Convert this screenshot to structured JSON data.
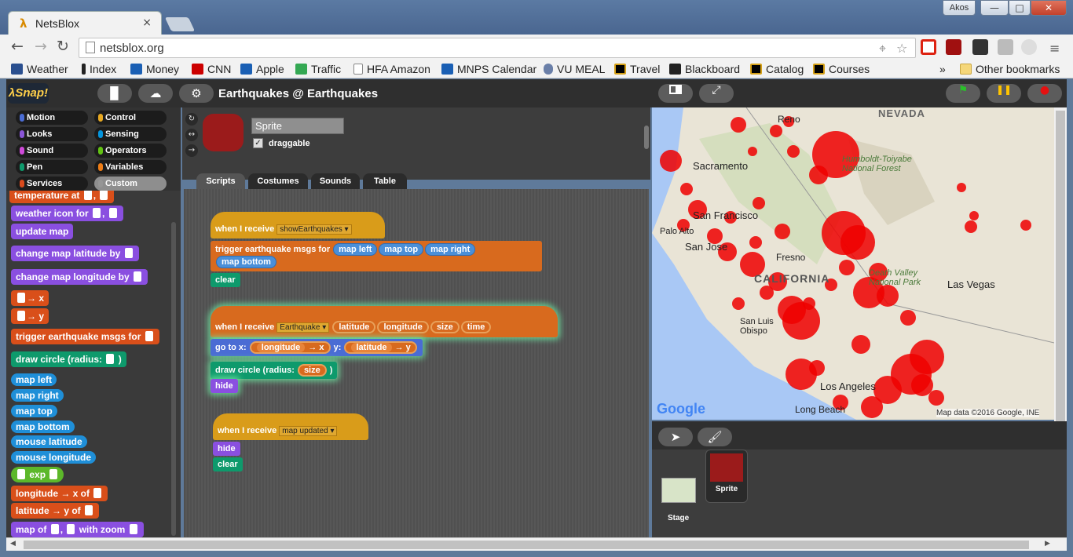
{
  "browser": {
    "tab_title": "NetsBlox",
    "tab_close": "×",
    "profile_label": "Akos",
    "window_buttons": [
      "—",
      "□",
      "✕"
    ],
    "url": "netsblox.org",
    "nav": {
      "back": "←",
      "forward": "→",
      "reload": "↻"
    },
    "omni_icons": [
      "⌖",
      "☆"
    ]
  },
  "bookmarks": {
    "items": [
      {
        "label": "Weather",
        "color": "#2a4f8f"
      },
      {
        "label": "Index",
        "color": "#222222"
      },
      {
        "label": "Money",
        "color": "#1a5fb4"
      },
      {
        "label": "CNN",
        "color": "#cc0000"
      },
      {
        "label": "Apple",
        "color": "#1a5fb4"
      },
      {
        "label": "Traffic",
        "color": "#34a853"
      },
      {
        "label": "HFA Amazon",
        "color": "#cccccc"
      },
      {
        "label": "MNPS Calendar",
        "color": "#1a5fb4"
      },
      {
        "label": "VU MEAL",
        "color": "#6a7fa8"
      },
      {
        "label": "Travel",
        "color": "#000000"
      },
      {
        "label": "Blackboard",
        "color": "#222222"
      },
      {
        "label": "Catalog",
        "color": "#000000"
      },
      {
        "label": "Courses",
        "color": "#000000"
      }
    ],
    "more": "»",
    "other": "Other bookmarks"
  },
  "snap": {
    "logo": "λSnap!",
    "project_title": "Earthquakes @ Earthquakes",
    "buttons": {
      "file": "▉",
      "cloud": "☁",
      "settings": "⚙"
    }
  },
  "categories": [
    {
      "label": "Motion",
      "color": "#4a6cd4"
    },
    {
      "label": "Control",
      "color": "#e6a822"
    },
    {
      "label": "Looks",
      "color": "#8a55d7"
    },
    {
      "label": "Sensing",
      "color": "#0494dc"
    },
    {
      "label": "Sound",
      "color": "#cf4ad9"
    },
    {
      "label": "Operators",
      "color": "#62c213"
    },
    {
      "label": "Pen",
      "color": "#0e9a6c"
    },
    {
      "label": "Variables",
      "color": "#ee7d16"
    },
    {
      "label": "Services",
      "color": "#d94a1c"
    },
    {
      "label": "Custom",
      "color": "#969696"
    }
  ],
  "palette_blocks": [
    {
      "label": "temperature at",
      "color": "#d94f1a",
      "slots": 2
    },
    {
      "label": "weather icon for",
      "color": "#8a4fe0",
      "slots": 2
    },
    {
      "label": "update map",
      "color": "#8a4fe0",
      "slots": 0
    },
    {
      "label": "change map latitude by",
      "color": "#8a4fe0",
      "slots": 1
    },
    {
      "label": "change map longitude by",
      "color": "#8a4fe0",
      "slots": 1
    },
    {
      "label": "→ x",
      "color": "#d94f1a",
      "slots": 1
    },
    {
      "label": "→ y",
      "color": "#d94f1a",
      "slots": 1
    },
    {
      "label": "trigger earthquake msgs for",
      "color": "#d94f1a",
      "slots": 1
    },
    {
      "label": "draw circle (radius:",
      "color": "#0e9a6c",
      "slots": 1
    },
    {
      "label": "map left",
      "color": "#1f8fd8",
      "slots": 0
    },
    {
      "label": "map right",
      "color": "#1f8fd8",
      "slots": 0
    },
    {
      "label": "map top",
      "color": "#1f8fd8",
      "slots": 0
    },
    {
      "label": "map bottom",
      "color": "#1f8fd8",
      "slots": 0
    },
    {
      "label": "mouse latitude",
      "color": "#1f8fd8",
      "slots": 0
    },
    {
      "label": "mouse longitude",
      "color": "#1f8fd8",
      "slots": 0
    },
    {
      "label": "exp",
      "color": "#5cb82a",
      "slots": 2
    },
    {
      "label": "longitude → x of",
      "color": "#d94f1a",
      "slots": 1
    },
    {
      "label": "latitude → y of",
      "color": "#d94f1a",
      "slots": 1
    },
    {
      "label": "map of",
      "color": "#8a4fe0",
      "slots": 3
    }
  ],
  "sprite": {
    "name": "Sprite",
    "draggable_label": "draggable",
    "checked": "✓",
    "rotation_icons": [
      "↻",
      "↔",
      "→"
    ]
  },
  "script_tabs": [
    "Scripts",
    "Costumes",
    "Sounds",
    "Table"
  ],
  "scripts": {
    "s1": {
      "hat": "when I receive",
      "msg": "showEarthquakes",
      "trigger": "trigger earthquake msgs for",
      "args": [
        "map left",
        "map top",
        "map right",
        "map bottom"
      ],
      "clear": "clear"
    },
    "s2": {
      "hat": "when I receive",
      "msg": "Earthquake",
      "params": [
        "latitude",
        "longitude",
        "size",
        "time"
      ],
      "goto": "go to x:",
      "goto_x": "longitude",
      "arrow_x": "→ x",
      "y_label": "y:",
      "goto_y": "latitude",
      "arrow_y": "→ y",
      "draw": "draw circle (radius:",
      "draw_arg": "size",
      "close_paren": ")",
      "hide": "hide"
    },
    "s3": {
      "hat": "when I receive",
      "msg": "map updated",
      "hide": "hide",
      "clear": "clear"
    }
  },
  "map": {
    "labels": [
      "NEVADA",
      "Reno",
      "Sacramento",
      "Humboldt-Toiyabe National Forest",
      "San Francisco",
      "Palo Alto",
      "San Jose",
      "Fresno",
      "CALIFORNIA",
      "Death Valley National Park",
      "Las Vegas",
      "San Luis Obispo",
      "Los Angeles",
      "Long Beach"
    ],
    "google": "Google",
    "attribution": "Map data ©2016 Google, INE"
  },
  "corral": {
    "stage_label": "Stage",
    "sprite_label": "Sprite",
    "tool_buttons": [
      "➤",
      "🖌"
    ]
  },
  "stage_controls": {
    "green_flag": "⚑",
    "pause": "❚❚",
    "stop": "●"
  }
}
